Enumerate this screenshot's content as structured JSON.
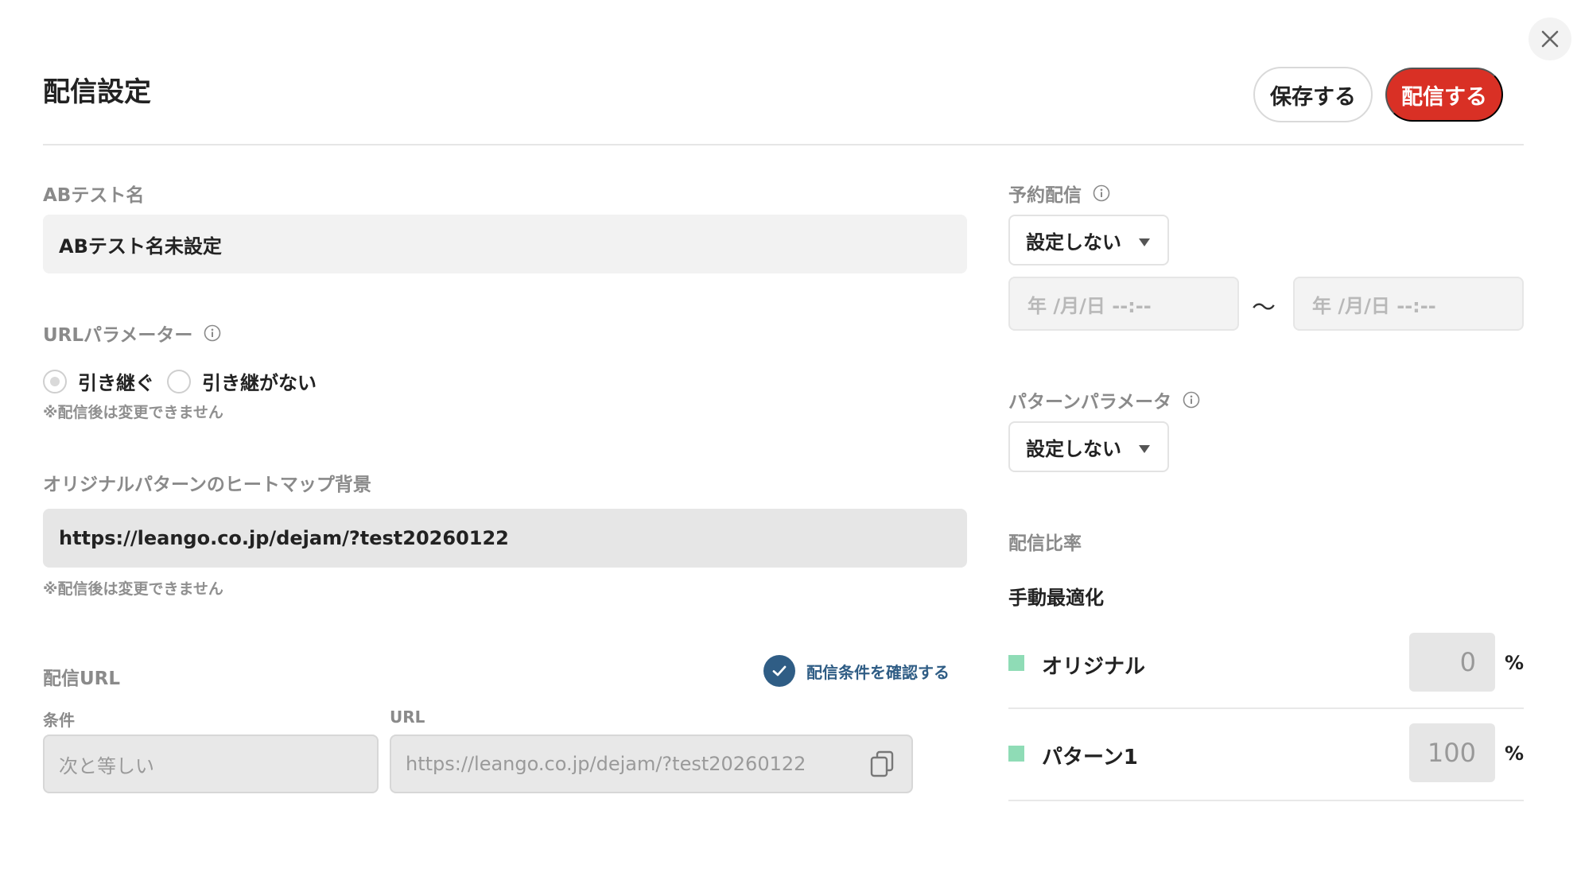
{
  "header": {
    "title": "配信設定",
    "save_label": "保存する",
    "publish_label": "配信する"
  },
  "left": {
    "ab_name": {
      "label": "ABテスト名",
      "value": "ABテスト名未設定"
    },
    "url_param": {
      "label": "URLパラメーター",
      "options": [
        "引き継ぐ",
        "引き継がない"
      ],
      "selected": "引き継ぐ",
      "note": "※配信後は変更できません"
    },
    "heatmap": {
      "label": "オリジナルパターンのヒートマップ背景",
      "value": "https://leango.co.jp/dejam/?test20260122",
      "note": "※配信後は変更できません"
    },
    "delivery_url": {
      "label": "配信URL",
      "check_link": "配信条件を確認する",
      "condition_label": "条件",
      "condition_value": "次と等しい",
      "url_label": "URL",
      "url_value": "https://leango.co.jp/dejam/?test20260122"
    }
  },
  "right": {
    "scheduled": {
      "label": "予約配信",
      "select_value": "設定しない",
      "date_placeholder_start": "年 /月/日 --:--",
      "date_separator": "〜",
      "date_placeholder_end": "年 /月/日 --:--"
    },
    "pattern_param": {
      "label": "パターンパラメータ",
      "select_value": "設定しない"
    },
    "ratio": {
      "label": "配信比率",
      "mode": "手動最適化",
      "swatch_color": "#8fdcb6",
      "rows": [
        {
          "name": "オリジナル",
          "value": "0",
          "unit": "%"
        },
        {
          "name": "パターン1",
          "value": "100",
          "unit": "%"
        }
      ]
    }
  },
  "colors": {
    "publish_button": "#d93025",
    "link": "#2f5d85"
  },
  "icons": {
    "close": "close-icon",
    "info": "info-icon",
    "check": "check-icon",
    "copy": "copy-icon",
    "dropdown": "chevron-down-icon"
  }
}
